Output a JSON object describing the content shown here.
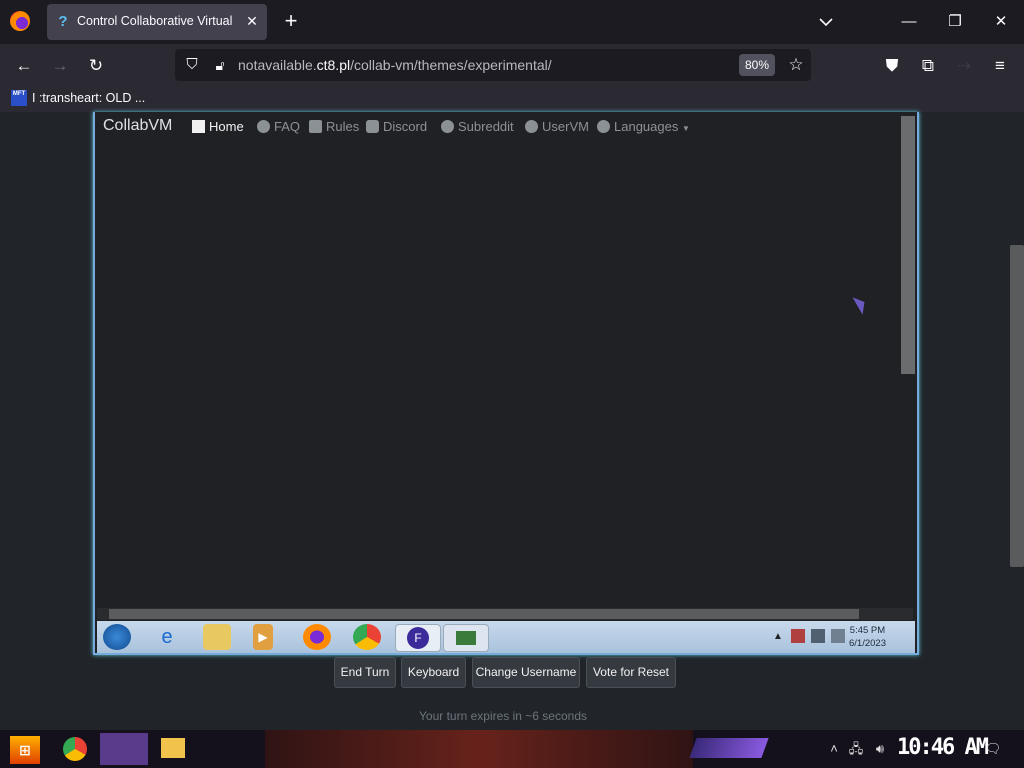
{
  "browser": {
    "tab_title": "Control Collaborative Virtual",
    "tab_favicon": "?",
    "new_tab_label": "+",
    "url_domain_prefix": "notavailable.",
    "url_domain": "ct8.pl",
    "url_path": "/collab-vm/themes/experimental/",
    "zoom": "80%",
    "bookmark_label": "I :transheart: OLD ...",
    "bookmark_icon_text": "MFT"
  },
  "collabvm": {
    "brand": "CollabVM",
    "nav": [
      "Home",
      "FAQ",
      "Rules",
      "Discord",
      "Subreddit",
      "UserVM",
      "Languages"
    ],
    "buttons": [
      "End Turn",
      "Keyboard",
      "Change Username",
      "Vote for Reset"
    ],
    "turn_text": "Your turn expires in ~6 seconds",
    "vm_clock_time": "5:45 PM",
    "vm_clock_date": "6/1/2023"
  },
  "host": {
    "clock": "10:46 AM"
  },
  "colors": {
    "accent": "#5bd0e0",
    "page_bg": "#212529"
  }
}
